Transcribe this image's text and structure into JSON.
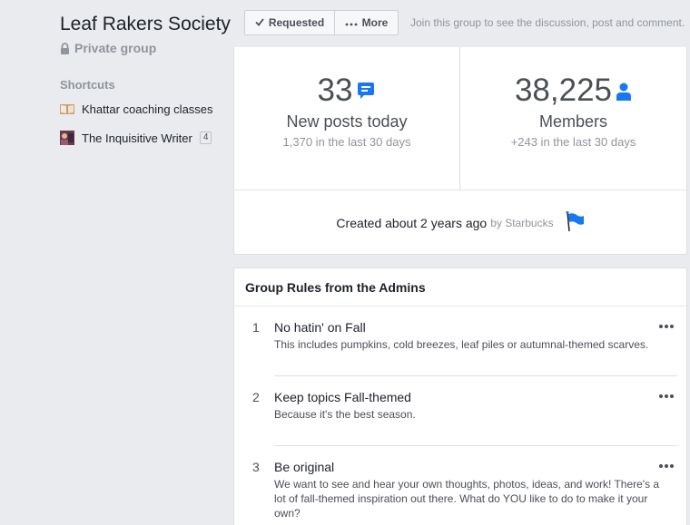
{
  "group": {
    "name": "Leaf Rakers Society",
    "privacy": "Private group"
  },
  "shortcuts": {
    "heading": "Shortcuts",
    "items": [
      {
        "label": "Khattar coaching classes",
        "icon": "book-thumbnail"
      },
      {
        "label": "The Inquisitive Writer",
        "icon": "group-thumbnail",
        "badge": "4"
      }
    ]
  },
  "topbar": {
    "requested_label": "Requested",
    "more_label": "More",
    "join_text": "Join this group to see the discussion, post and comment."
  },
  "stats": {
    "posts": {
      "number": "33",
      "label": "New posts today",
      "sub": "1,370 in the last 30 days",
      "icon": "chat-bubble-icon"
    },
    "members": {
      "number": "38,225",
      "label": "Members",
      "sub": "+243 in the last 30 days",
      "icon": "person-icon"
    },
    "created": "Created about 2 years ago",
    "created_by": "by Starbucks"
  },
  "rules": {
    "heading": "Group Rules from the Admins",
    "items": [
      {
        "num": "1",
        "title": "No hatin' on Fall",
        "desc": "This includes pumpkins, cold breezes, leaf piles or autumnal-themed scarves."
      },
      {
        "num": "2",
        "title": "Keep topics Fall-themed",
        "desc": "Because it's the best season."
      },
      {
        "num": "3",
        "title": "Be original",
        "desc": "We want to see and hear your own thoughts, photos, ideas, and work! There's a lot of fall-themed inspiration out there. What do YOU like to do to make it your own?"
      }
    ]
  },
  "colors": {
    "accent": "#1877f2",
    "background": "#e9ebee",
    "muted": "#90949c"
  }
}
